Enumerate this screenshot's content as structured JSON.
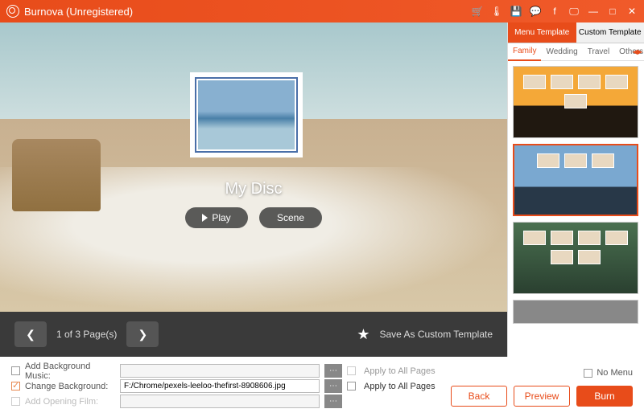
{
  "titlebar": {
    "title": "Burnova (Unregistered)"
  },
  "preview": {
    "disc_title": "My Disc",
    "play_label": "Play",
    "scene_label": "Scene"
  },
  "pager": {
    "text": "1 of 3 Page(s)",
    "save_template": "Save As Custom Template"
  },
  "sidebar": {
    "tabs": {
      "menu": "Menu Template",
      "custom": "Custom Template"
    },
    "categories": [
      "Family",
      "Wedding",
      "Travel",
      "Others"
    ]
  },
  "bottom": {
    "add_music": "Add Background Music:",
    "change_bg": "Change Background:",
    "bg_path": "F:/Chrome/pexels-leeloo-thefirst-8908606.jpg",
    "add_film": "Add Opening Film:",
    "apply_all": "Apply to All Pages",
    "no_menu": "No Menu",
    "back": "Back",
    "preview": "Preview",
    "burn": "Burn"
  }
}
